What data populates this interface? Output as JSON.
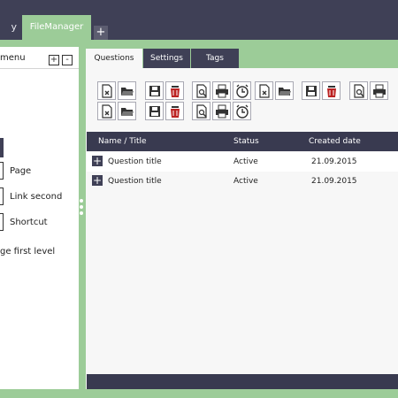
{
  "window_tabs": {
    "gallery": "y",
    "filemanager": "FileManager",
    "add": "+"
  },
  "menu": {
    "title": "menu",
    "plus": "+",
    "minus": "-",
    "items": [
      "Page",
      "Link second",
      "Shortcut",
      "ge first level"
    ]
  },
  "tabs": [
    "Questions",
    "Settings",
    "Tags"
  ],
  "toolbar_icons": [
    "new-file-icon",
    "open-folder-icon",
    "save-icon",
    "delete-icon",
    "preview-icon",
    "print-icon",
    "schedule-icon",
    "new-file-icon",
    "open-folder-icon",
    "save-icon",
    "delete-icon",
    "preview-icon",
    "print-icon",
    "schedule-icon"
  ],
  "table": {
    "headers": [
      "Name / Title",
      "Status",
      "Created date"
    ],
    "rows": [
      {
        "title": "Question title",
        "status": "Active",
        "date": "21.09.2015"
      },
      {
        "title": "Question title",
        "status": "Active",
        "date": "21.09.2015"
      }
    ],
    "expand": "+"
  },
  "colors": {
    "dark": "#3f4056",
    "green": "#9ccc98",
    "panel": "#f7f7f7"
  }
}
